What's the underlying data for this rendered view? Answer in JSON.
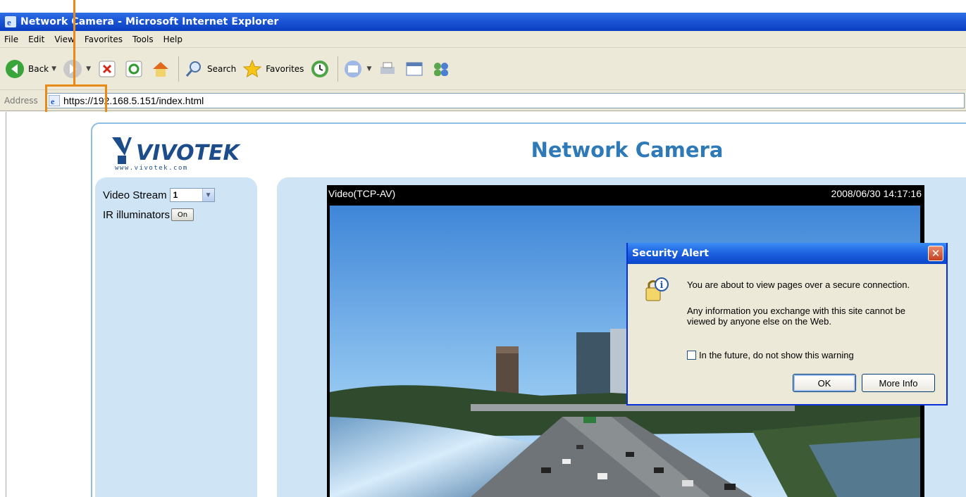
{
  "window": {
    "title": "Network Camera - Microsoft Internet Explorer"
  },
  "menu": [
    "File",
    "Edit",
    "View",
    "Favorites",
    "Tools",
    "Help"
  ],
  "toolbar": {
    "back_label": "Back",
    "search_label": "Search",
    "favorites_label": "Favorites"
  },
  "address": {
    "label": "Address",
    "url": "https://192.168.5.151/index.html"
  },
  "page": {
    "title": "Network Camera",
    "logo_text": "VIVOTEK",
    "logo_sub": "www.vivotek.com",
    "video_stream_label": "Video Stream",
    "video_stream_value": "1",
    "ir_label": "IR illuminators",
    "ir_button": "On",
    "video_header_left": "Video(TCP-AV)",
    "video_header_right": "2008/06/30 14:17:16"
  },
  "dialog": {
    "title": "Security Alert",
    "line1": "You are about to view pages over a secure connection.",
    "line2": "Any information you exchange with this site cannot be viewed by anyone else on the Web.",
    "checkbox_label": "In the future, do not show this warning",
    "ok_label": "OK",
    "more_label": "More Info"
  },
  "colors": {
    "accent": "#2e7ab8",
    "panel": "#cfe5f6",
    "highlight": "#e88a17"
  }
}
